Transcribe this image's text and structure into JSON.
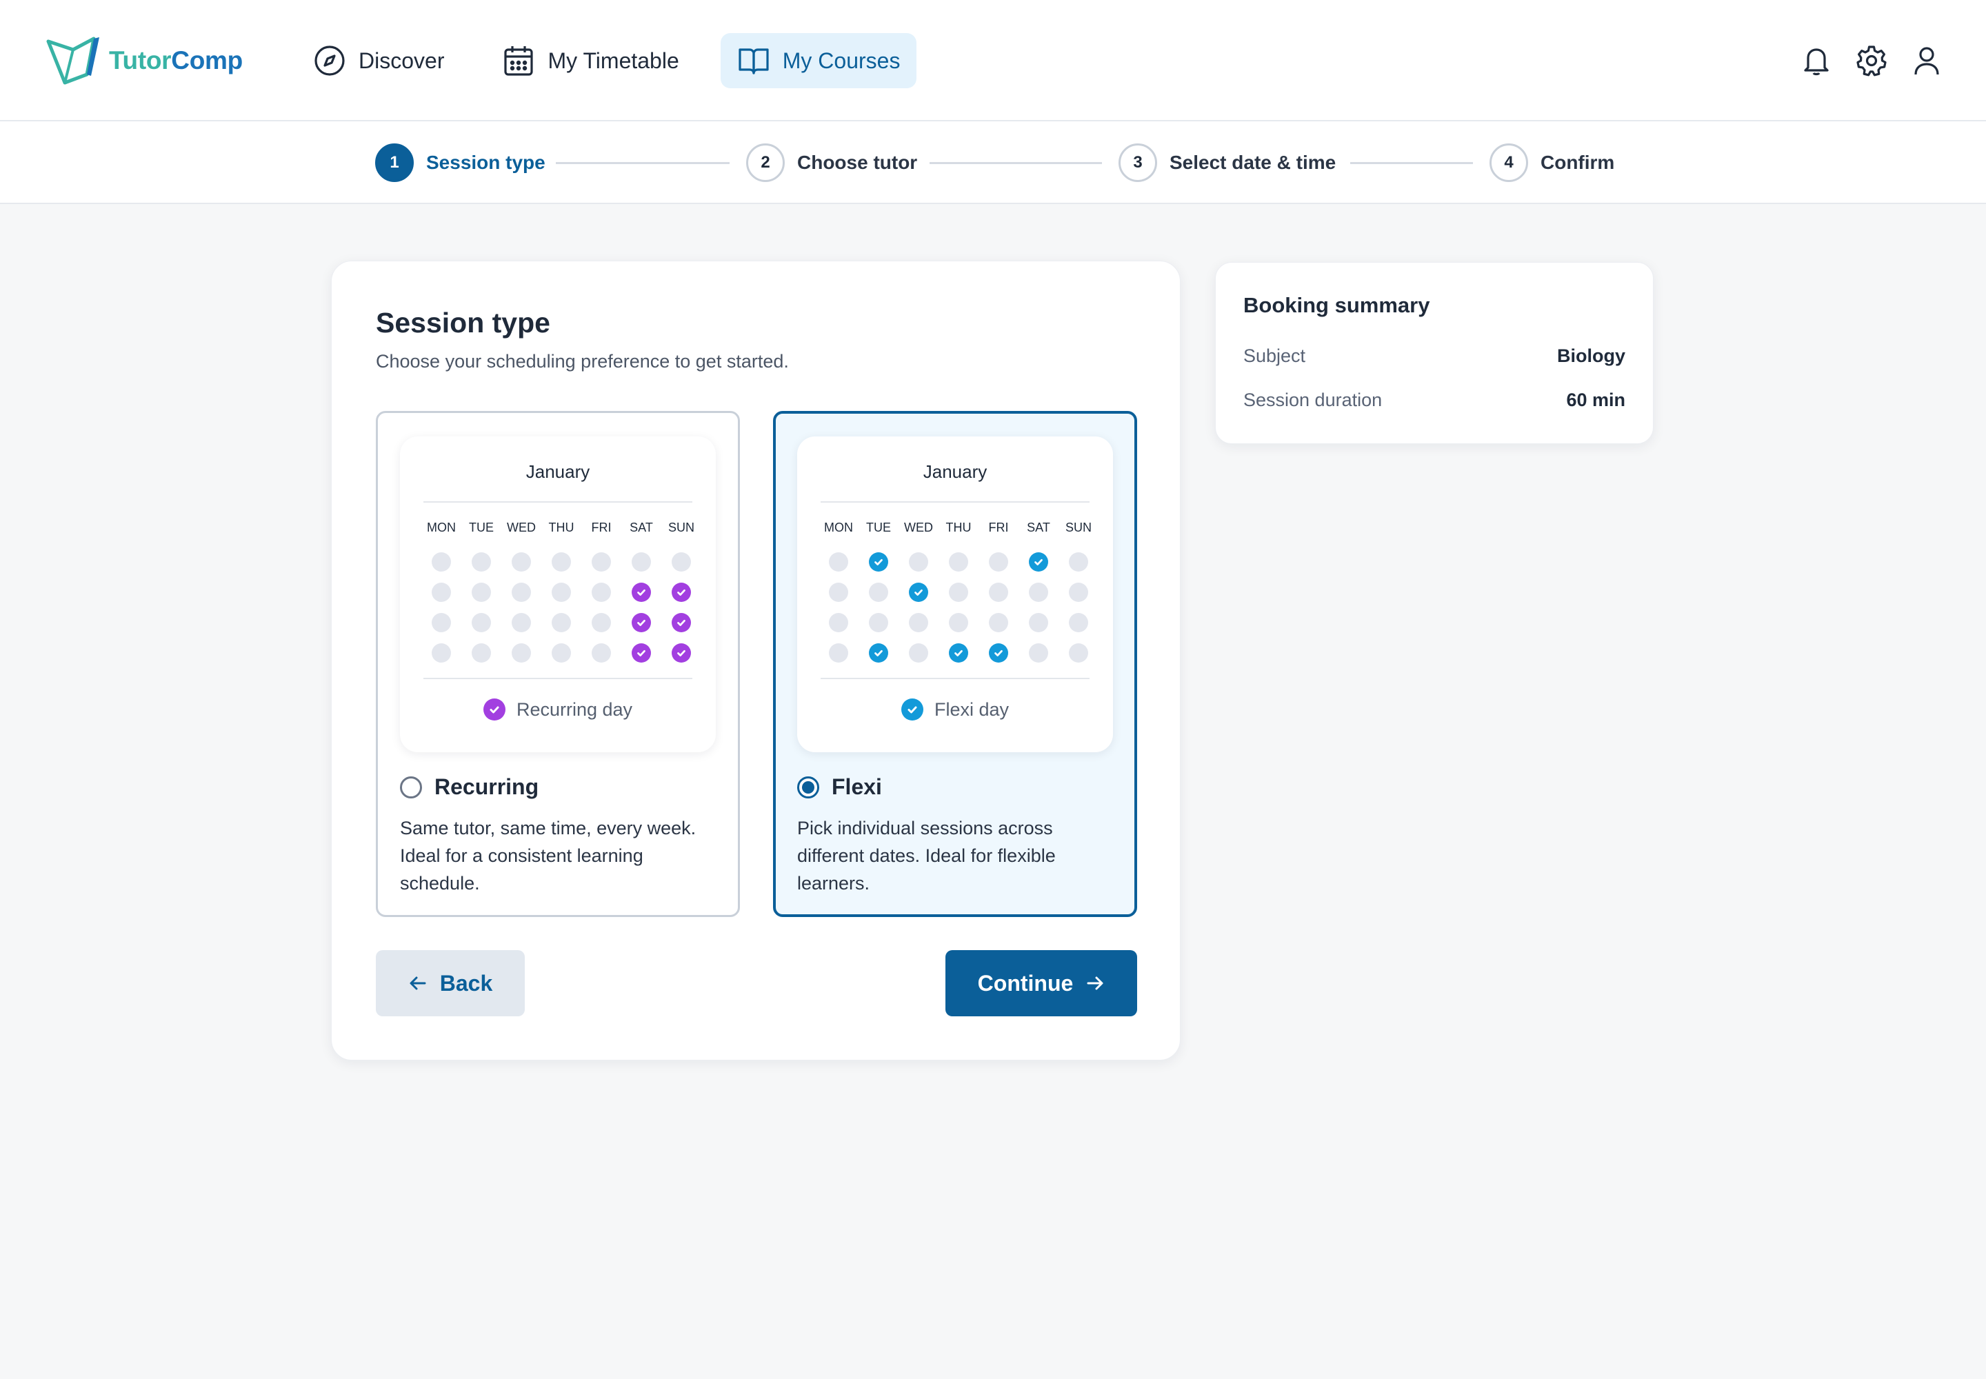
{
  "app": {
    "logo_part1": "Tutor",
    "logo_part2": "Comp",
    "brand_colors": {
      "teal": "#38b3a5",
      "blue": "#1a73b8",
      "primary": "#0b5f99"
    }
  },
  "nav": {
    "items": [
      {
        "label": "Discover",
        "icon": "compass-icon",
        "active": false
      },
      {
        "label": "My Timetable",
        "icon": "calendar-icon",
        "active": false
      },
      {
        "label": "My Courses",
        "icon": "book-open-icon",
        "active": true
      }
    ],
    "right_icons": [
      "bell-icon",
      "gear-icon",
      "user-icon"
    ]
  },
  "stepper": {
    "steps": [
      {
        "num": "1",
        "label": "Session type",
        "active": true
      },
      {
        "num": "2",
        "label": "Choose tutor",
        "active": false
      },
      {
        "num": "3",
        "label": "Select date & time",
        "active": false
      },
      {
        "num": "4",
        "label": "Confirm",
        "active": false
      }
    ]
  },
  "session": {
    "title": "Session type",
    "subtitle": "Choose your scheduling preference to get started.",
    "weekdays": [
      "MON",
      "TUE",
      "WED",
      "THU",
      "FRI",
      "SAT",
      "SUN"
    ],
    "options": [
      {
        "key": "recurring",
        "name": "Recurring",
        "selected": false,
        "calendar_month": "January",
        "legend": "Recurring day",
        "check_color": "#a23fe0",
        "checked_days": [
          [
            0,
            0,
            0,
            0,
            0,
            0,
            0
          ],
          [
            0,
            0,
            0,
            0,
            0,
            1,
            1
          ],
          [
            0,
            0,
            0,
            0,
            0,
            1,
            1
          ],
          [
            0,
            0,
            0,
            0,
            0,
            1,
            1
          ]
        ],
        "description": "Same tutor, same time, every week. Ideal for a consistent learning schedule."
      },
      {
        "key": "flexi",
        "name": "Flexi",
        "selected": true,
        "calendar_month": "January",
        "legend": "Flexi day",
        "check_color": "#139ad9",
        "checked_days": [
          [
            0,
            1,
            0,
            0,
            0,
            1,
            0
          ],
          [
            0,
            0,
            1,
            0,
            0,
            0,
            0
          ],
          [
            0,
            0,
            0,
            0,
            0,
            0,
            0
          ],
          [
            0,
            1,
            0,
            1,
            1,
            0,
            0
          ]
        ],
        "description": "Pick individual sessions across different dates. Ideal for flexible learners."
      }
    ],
    "back_label": "Back",
    "continue_label": "Continue"
  },
  "summary": {
    "title": "Booking summary",
    "rows": [
      {
        "key": "Subject",
        "value": "Biology"
      },
      {
        "key": "Session duration",
        "value": "60 min"
      }
    ]
  }
}
